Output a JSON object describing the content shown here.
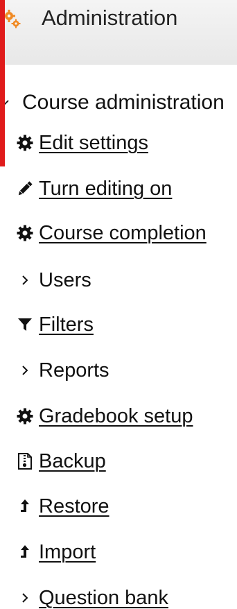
{
  "header": {
    "title": "Administration",
    "icon": "gears-icon",
    "accent_color": "#e01b1b",
    "icon_color": "#f08a24"
  },
  "course_admin": {
    "label": "Course administration",
    "expanded": true
  },
  "items": [
    {
      "label": "Edit settings",
      "icon": "gear-icon",
      "kind": "link"
    },
    {
      "label": "Turn editing on",
      "icon": "pencil-icon",
      "kind": "link"
    },
    {
      "label": "Course completion",
      "icon": "gear-icon",
      "kind": "link"
    },
    {
      "label": "Users",
      "icon": "chevron-right-icon",
      "kind": "branch"
    },
    {
      "label": "Filters",
      "icon": "filter-icon",
      "kind": "link"
    },
    {
      "label": "Reports",
      "icon": "chevron-right-icon",
      "kind": "branch"
    },
    {
      "label": "Gradebook setup",
      "icon": "gear-icon",
      "kind": "link"
    },
    {
      "label": "Backup",
      "icon": "archive-icon",
      "kind": "link"
    },
    {
      "label": "Restore",
      "icon": "upload-arrow-icon",
      "kind": "link"
    },
    {
      "label": "Import",
      "icon": "upload-arrow-icon",
      "kind": "link"
    },
    {
      "label": "Question bank",
      "icon": "chevron-right-icon",
      "kind": "branch-link"
    }
  ]
}
